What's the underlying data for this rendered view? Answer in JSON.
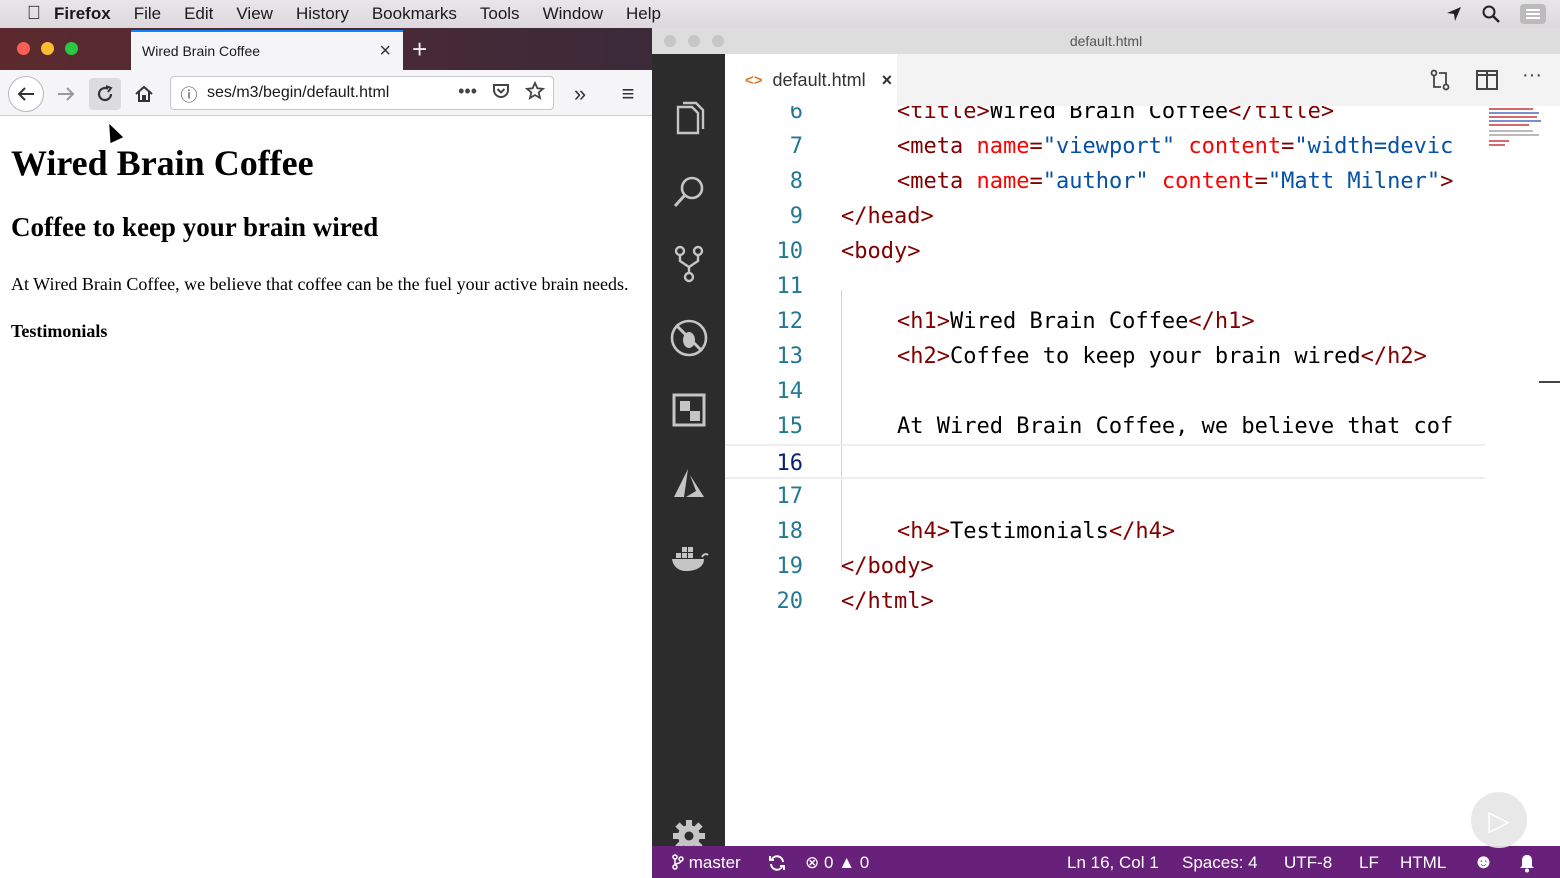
{
  "menubar": {
    "app_name": "Firefox",
    "items": [
      "File",
      "Edit",
      "View",
      "History",
      "Bookmarks",
      "Tools",
      "Window",
      "Help"
    ]
  },
  "firefox": {
    "tab_title": "Wired Brain Coffee",
    "url": "ses/m3/begin/default.html",
    "page": {
      "h1": "Wired Brain Coffee",
      "h2": "Coffee to keep your brain wired",
      "paragraph": "At Wired Brain Coffee, we believe that coffee can be the fuel your active brain needs.",
      "h4": "Testimonials"
    }
  },
  "vscode": {
    "window_title": "default.html",
    "tab_label": "default.html",
    "code_lines": [
      {
        "num": "6",
        "text": "<title>Wired Brain Coffee</title>"
      },
      {
        "num": "7",
        "text": "<meta name=\"viewport\" content=\"width=devic"
      },
      {
        "num": "8",
        "text": "<meta name=\"author\" content=\"Matt Milner\">"
      },
      {
        "num": "9",
        "text": "</head>"
      },
      {
        "num": "10",
        "text": "<body>"
      },
      {
        "num": "11",
        "text": ""
      },
      {
        "num": "12",
        "text": "<h1>Wired Brain Coffee</h1>"
      },
      {
        "num": "13",
        "text": "<h2>Coffee to keep your brain wired</h2>"
      },
      {
        "num": "14",
        "text": ""
      },
      {
        "num": "15",
        "text": "At Wired Brain Coffee, we believe that cof"
      },
      {
        "num": "16",
        "text": ""
      },
      {
        "num": "17",
        "text": ""
      },
      {
        "num": "18",
        "text": "<h4>Testimonials</h4>"
      },
      {
        "num": "19",
        "text": "</body>"
      },
      {
        "num": "20",
        "text": "</html>"
      }
    ],
    "current_line": "16",
    "status": {
      "branch": "master",
      "errors": "0",
      "warnings": "0",
      "cursor": "Ln 16, Col 1",
      "spaces": "Spaces: 4",
      "encoding": "UTF-8",
      "eol": "LF",
      "language": "HTML"
    },
    "colors": {
      "statusbar": "#68217a",
      "activitybar": "#2c2c2c",
      "tag": "#800000",
      "attribute": "#ff0000",
      "string": "#0451a5",
      "line_number": "#237893"
    }
  }
}
